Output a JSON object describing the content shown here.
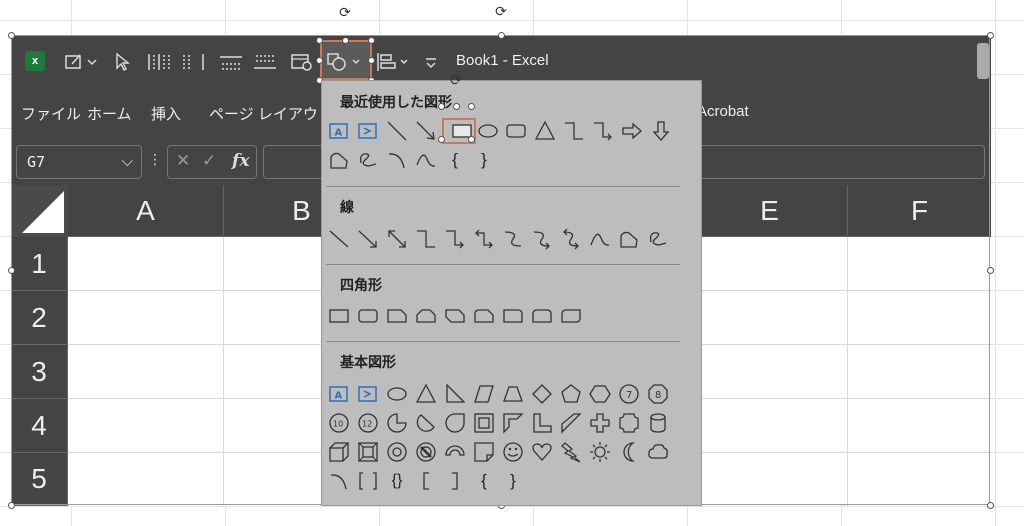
{
  "app": {
    "title": "Book1  -  Excel",
    "logo_letter": "x"
  },
  "quick_access": {
    "icons": [
      "excel-logo-icon",
      "edit-icon",
      "select-pointer-icon",
      "distribute-vertical-icon",
      "distribute-horizontal-icon",
      "align-top-icon",
      "align-middle-icon",
      "screen-record-icon",
      "shapes-icon",
      "align-icon",
      "customize-icon"
    ]
  },
  "ribbon": {
    "tabs": [
      "ファイル",
      "ホーム",
      "挿入",
      "ページ レイアウト",
      "Acrobat"
    ]
  },
  "formula_bar": {
    "name_box": "G7",
    "chevron": "⌵",
    "dots": "⋮",
    "cancel": "✕",
    "enter": "✓",
    "fx": "fx",
    "value": ""
  },
  "sheet": {
    "columns": [
      "A",
      "B",
      "E",
      "F"
    ],
    "rows": [
      "1",
      "2",
      "3",
      "4",
      "5"
    ]
  },
  "shapes_menu": {
    "recent_title": "最近使用した図形",
    "lines_title": "線",
    "rect_title": "四角形",
    "basic_title": "基本図形",
    "labels": {
      "brace_open": "{",
      "brace_close": "}",
      "braces_pair": "{}",
      "octagon_7": "7",
      "octagon_8": "8",
      "num_10": "10",
      "num_12": "12",
      "text_a": "A"
    }
  },
  "colors": {
    "window": "#444444",
    "menu_bg": "#bdbdbd",
    "accent": "#1d7a3e",
    "shape_blue": "#2f6fbf",
    "highlight": "#c87a5a"
  }
}
